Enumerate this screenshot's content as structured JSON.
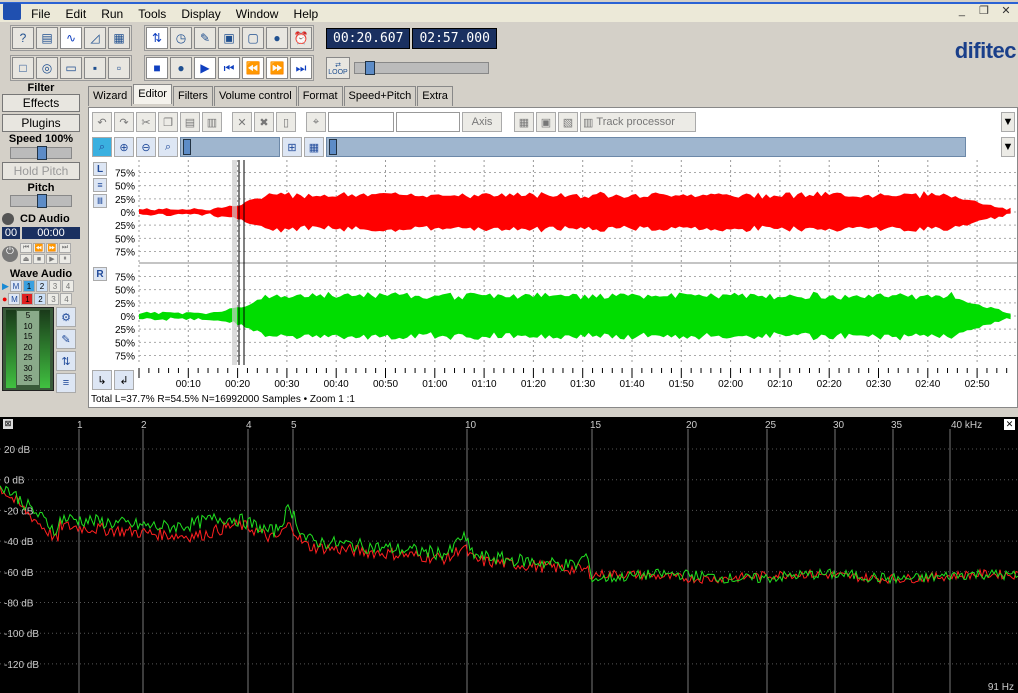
{
  "menu": {
    "items": [
      "File",
      "Edit",
      "Run",
      "Tools",
      "Display",
      "Window",
      "Help"
    ]
  },
  "window_controls": {
    "minimize": "_",
    "restore": "❐",
    "close": "✕"
  },
  "time": {
    "position": "00:20.607",
    "duration": "02:57.000"
  },
  "transport": {
    "loop_label": "LOOP"
  },
  "brand": {
    "name": "difitec"
  },
  "left_panel": {
    "filter_title": "Filter",
    "effects_label": "Effects",
    "plugins_label": "Plugins",
    "speed_label": "Speed 100%",
    "hold_pitch_label": "Hold Pitch",
    "pitch_label": "Pitch",
    "cd_audio_label": "CD Audio",
    "cd_track": "00",
    "cd_time": "00:00",
    "wave_audio_label": "Wave Audio",
    "channel_buttons": [
      "M",
      "1",
      "2",
      "3",
      "4"
    ],
    "vu_labels": [
      "5",
      "10",
      "15",
      "20",
      "25",
      "30",
      "35"
    ]
  },
  "tabs": [
    "Wizard",
    "Editor",
    "Filters",
    "Volume control",
    "Format",
    "Speed+Pitch",
    "Extra"
  ],
  "editor": {
    "axis_label": "Axis",
    "track_processor_label": "Track processor",
    "channel_left": "L",
    "channel_right": "R",
    "percent_labels": [
      "75%",
      "50%",
      "25%",
      "0%",
      "25%",
      "50%",
      "75%"
    ],
    "time_ticks": [
      "00:10",
      "00:20",
      "00:30",
      "00:40",
      "00:50",
      "01:00",
      "01:10",
      "01:20",
      "01:30",
      "01:40",
      "01:50",
      "02:00",
      "02:10",
      "02:20",
      "02:30",
      "02:40",
      "02:50"
    ],
    "status": "Total L=37.7% R=54.5% N=16992000 Samples • Zoom 1 :1",
    "colors": {
      "left": "#ff0000",
      "right": "#00dd00"
    }
  },
  "spectrum": {
    "freq_labels": [
      "1",
      "2",
      "4",
      "5",
      "10",
      "15",
      "20",
      "25",
      "30",
      "35",
      "40 kHz"
    ],
    "db_labels": [
      "20 dB",
      "0 dB",
      "-20 dB",
      "-40 dB",
      "-60 dB",
      "-80 dB",
      "-100 dB",
      "-120 dB"
    ],
    "footer": "91 Hz",
    "close": "✕",
    "colors": {
      "left": "#ff2020",
      "right": "#20e020"
    }
  }
}
